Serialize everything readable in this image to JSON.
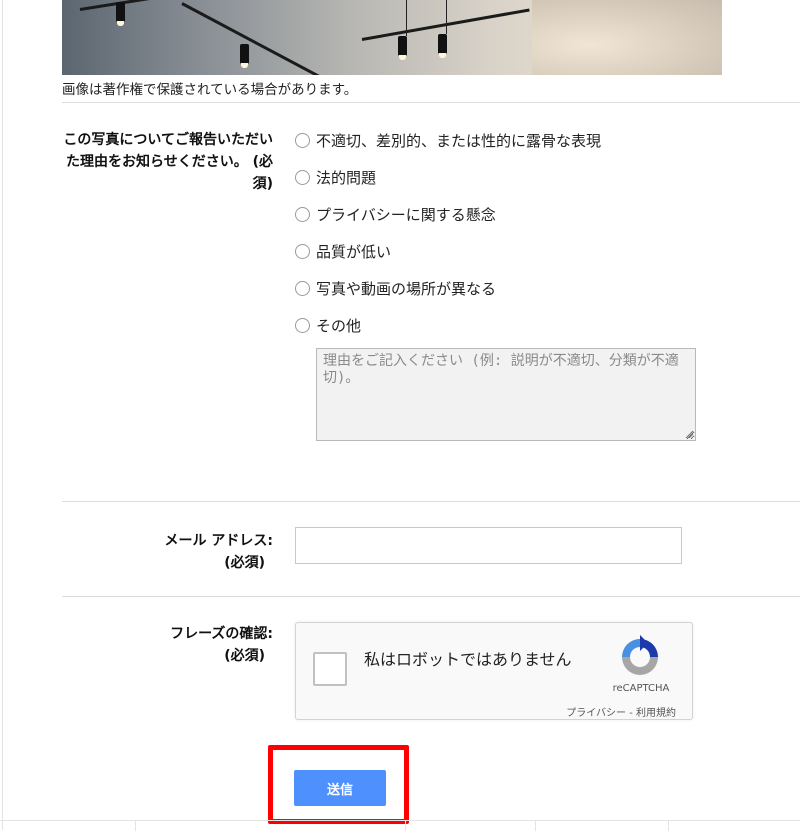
{
  "image": {
    "caption": "画像は著作権で保護されている場合があります。"
  },
  "report": {
    "question_label": "この写真についてご報告いただいた理由をお知らせください。",
    "question_required": "(必須)",
    "options": [
      "不適切、差別的、または性的に露骨な表現",
      "法的問題",
      "プライバシーに関する懸念",
      "品質が低い",
      "写真や動画の場所が異なる",
      "その他"
    ],
    "reason_placeholder": "理由をご記入ください (例: 説明が不適切、分類が不適切)。"
  },
  "email": {
    "label": "メール アドレス:",
    "required": "(必須)",
    "value": ""
  },
  "captcha": {
    "label": "フレーズの確認:",
    "required": "(必須)",
    "checkbox_text": "私はロボットではありません",
    "brand": "reCAPTCHA",
    "privacy_link": "プライバシー",
    "separator": " - ",
    "terms_link": "利用規約"
  },
  "form": {
    "submit_label": "送信"
  },
  "colors": {
    "submit_bg": "#4d90fe",
    "highlight_border": "#ff0000"
  }
}
